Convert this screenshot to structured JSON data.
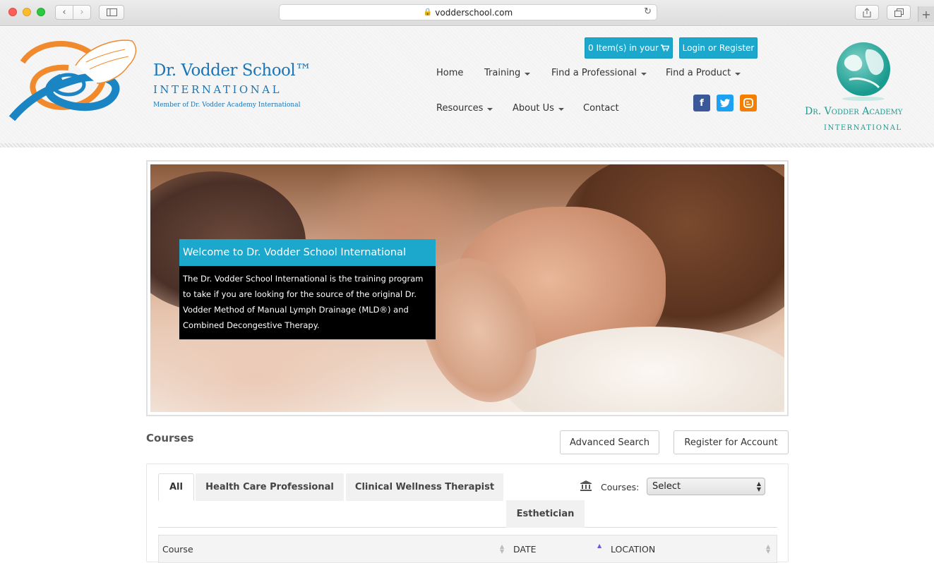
{
  "browser": {
    "url": "vodderschool.com"
  },
  "header": {
    "brand_name": "Dr. Vodder School™",
    "brand_sub": "INTERNATIONAL",
    "brand_member": "Member of Dr. Vodder Academy International",
    "cart_label": "0 Item(s) in your",
    "login_label": "Login or Register",
    "nav": [
      {
        "label": "Home",
        "dropdown": false
      },
      {
        "label": "Training",
        "dropdown": true
      },
      {
        "label": "Find a Professional",
        "dropdown": true
      },
      {
        "label": "Find a Product",
        "dropdown": true
      },
      {
        "label": "Resources",
        "dropdown": true
      },
      {
        "label": "About Us",
        "dropdown": true
      },
      {
        "label": "Contact",
        "dropdown": false
      }
    ],
    "social": [
      "facebook-icon",
      "twitter-icon",
      "blogger-icon"
    ],
    "academy_name": "Dr. Vodder Academy",
    "academy_sub": "INTERNATIONAL"
  },
  "hero": {
    "title": "Welcome to Dr. Vodder School International",
    "body": "The Dr. Vodder School International is the training program to take if you are looking for the source of the original Dr. Vodder Method of Manual Lymph Drainage (MLD®) and Combined Decongestive Therapy."
  },
  "courses": {
    "heading": "Courses",
    "advanced_search": "Advanced Search",
    "register_account": "Register for Account",
    "tabs": [
      "All",
      "Health Care Professional",
      "Clinical Wellness Therapist",
      "Esthetician"
    ],
    "active_tab": "All",
    "filter_label": "Courses:",
    "filter_value": "Select",
    "columns": [
      "Course",
      "DATE",
      "LOCATION"
    ]
  },
  "colors": {
    "accent": "#1ba8cc",
    "brand_blue": "#1b75b6",
    "academy_teal": "#1a9b8f"
  }
}
